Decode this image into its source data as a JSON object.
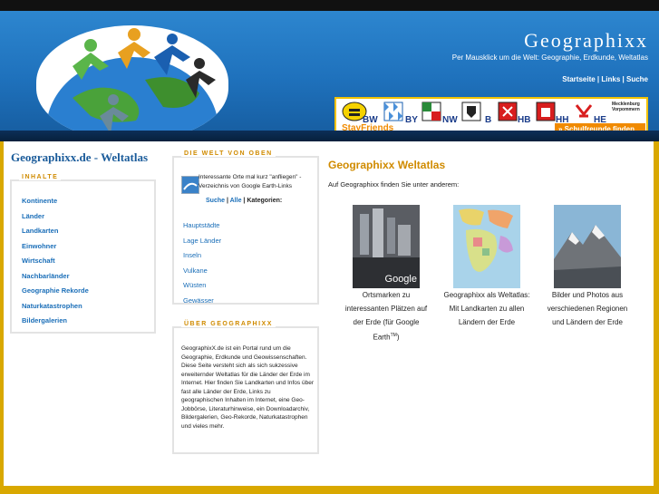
{
  "header": {
    "site_title": "Geographixx",
    "tagline": "Per Mausklick um die Welt: Geographie, Erdkunde, Weltatlas",
    "links": [
      "Startseite",
      "Links",
      "Suche"
    ],
    "link_sep": " | "
  },
  "banner": {
    "states": [
      "BW",
      "BY",
      "NW",
      "B",
      "HB",
      "HH",
      "HE"
    ],
    "extra_state": "Mecklenburg Vorpommern",
    "logo_text": "StayFriends",
    "button_label": "» Schulfreunde finden"
  },
  "left": {
    "page_title": "Geographixx.de - Weltatlas",
    "box_title": "INHALTE",
    "items": [
      "Kontinente",
      "Länder",
      "Landkarten",
      "Einwohner",
      "Wirtschaft",
      "Nachbarländer",
      "Geographie Rekorde",
      "Naturkatastrophen",
      "Bildergalerien"
    ]
  },
  "middle": {
    "welt_title": "DIE WELT VON OBEN",
    "welt_text": "Interessante Orte mal kurz \"anfliegen\" - Verzeichnis von Google Earth-Links",
    "links_suche": "Suche",
    "links_alle": "Alle",
    "links_kategorien": "Kategorien:",
    "categories": [
      "Hauptstädte",
      "Lage Länder",
      "Inseln",
      "Vulkane",
      "Wüsten",
      "Gewässer"
    ],
    "about_title": "ÜBER GEOGRAPHIXX",
    "about_text": "GeographixX.de ist ein Portal rund um die Geographie, Erdkunde und Geowissenschaften. Diese Seite versteht sich als sich sukzessive erweiternder Weltatlas für die Länder der Erde im Internet. Hier finden Sie Landkarten und Infos über fast alle Länder der Erde, Links zu geographischen Inhalten im Internet, eine Geo-Jobbörse, Literaturhinweise, ein Downloadarchiv, Bildergalerien, Geo-Rekorde, Naturkatastrophen und vieles mehr."
  },
  "main": {
    "title": "Geographixx Weltatlas",
    "intro": "Auf Geographixx finden Sie unter anderem:",
    "card1_caption": "Ortsmarken zu interessanten Plätzen auf der Erde (für Google Earth",
    "card1_sup": "TM",
    "card1_close": ")",
    "card1_watermark": "Google",
    "card2_caption": "Geographixx als Weltatlas: Mit Landkarten zu allen Ländern der Erde",
    "card3_caption": "Bilder und Photos aus verschiedenen Regionen und Ländern der Erde"
  }
}
